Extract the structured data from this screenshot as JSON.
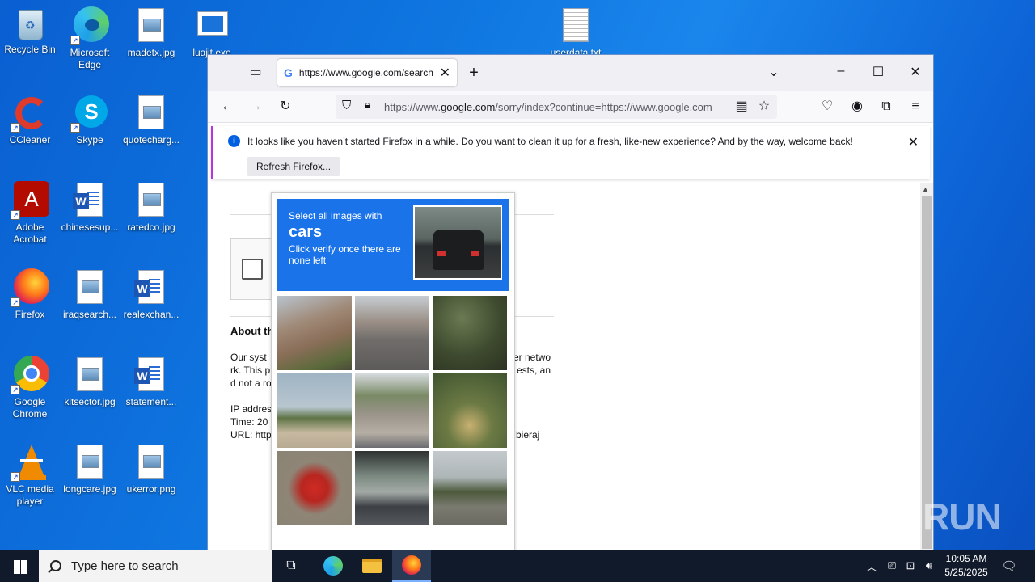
{
  "desktop": {
    "icons": [
      {
        "label": "Recycle Bin"
      },
      {
        "label": "Microsoft Edge"
      },
      {
        "label": "madetx.jpg"
      },
      {
        "label": "luajit.exe"
      },
      {
        "label": "userdata.txt"
      },
      {
        "label": "CCleaner"
      },
      {
        "label": "Skype"
      },
      {
        "label": "quotecharg..."
      },
      {
        "label": "Adobe Acrobat"
      },
      {
        "label": "chinesesup..."
      },
      {
        "label": "ratedco.jpg"
      },
      {
        "label": "Firefox"
      },
      {
        "label": "iraqsearch..."
      },
      {
        "label": "realexchan..."
      },
      {
        "label": "Google Chrome"
      },
      {
        "label": "kitsector.jpg"
      },
      {
        "label": "statement..."
      },
      {
        "label": "VLC media player"
      },
      {
        "label": "longcare.jpg"
      },
      {
        "label": "ukerror.png"
      }
    ]
  },
  "browser": {
    "tab_title": "https://www.google.com/search",
    "url_prefix": "https://www.",
    "url_domain": "google.com",
    "url_rest": "/sorry/index?continue=https://www.google.com",
    "notice": {
      "message": "It looks like you haven’t started Firefox in a while. Do you want to clean it up for a fresh, like-new experience? And by the way, welcome back!",
      "button": "Refresh Firefox..."
    },
    "page": {
      "about_heading": "About th",
      "body_line1_left": "Our syst",
      "body_line1_right": "er netwo",
      "body_line2_left": "rk. This p",
      "body_line2_right": "ests, an",
      "body_line3": "d not a ro",
      "ip_label": "IP addres",
      "time_label": "Time: 20",
      "url_label": "URL: http",
      "url_tail": "bieraj"
    }
  },
  "captcha": {
    "instruction": "Select all images with",
    "target": "cars",
    "hint": "Click verify once there are none left"
  },
  "taskbar": {
    "search_placeholder": "Type here to search",
    "time": "10:05 AM",
    "date": "5/25/2025"
  },
  "watermark": "ANY RUN"
}
